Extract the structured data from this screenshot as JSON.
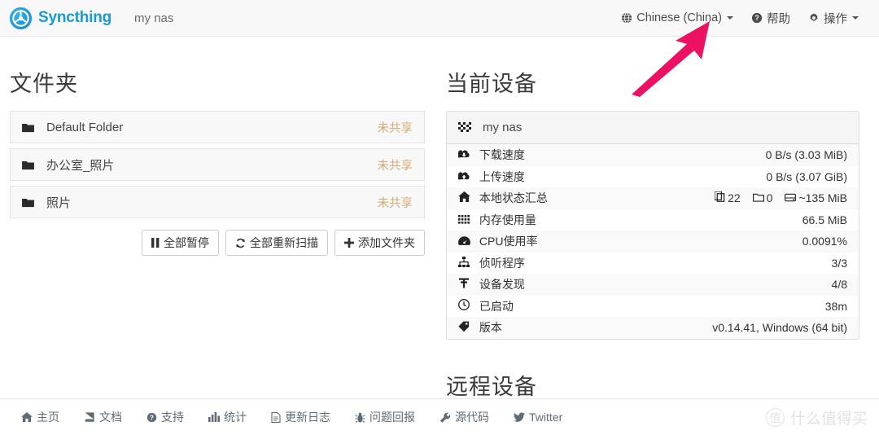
{
  "navbar": {
    "brand": "Syncthing",
    "brand_logo_icon": "syncthing-logo-icon",
    "device_name": "my nas",
    "language": {
      "label": "Chinese (China)",
      "icon": "globe-icon"
    },
    "help": {
      "label": "帮助",
      "icon": "question-circle-icon"
    },
    "actions": {
      "label": "操作",
      "icon": "gear-icon"
    }
  },
  "folders": {
    "title": "文件夹",
    "items": [
      {
        "name": "Default Folder",
        "status": "未共享",
        "icon": "folder-icon"
      },
      {
        "name": "办公室_照片",
        "status": "未共享",
        "icon": "folder-icon"
      },
      {
        "name": "照片",
        "status": "未共享",
        "icon": "folder-icon"
      }
    ],
    "buttons": [
      {
        "label": "全部暂停",
        "icon": "pause-icon"
      },
      {
        "label": "全部重新扫描",
        "icon": "refresh-icon"
      },
      {
        "label": "添加文件夹",
        "icon": "plus-icon"
      }
    ]
  },
  "this_device": {
    "title": "当前设备",
    "device_name": "my nas",
    "device_icon": "qrcode-icon",
    "stats": [
      {
        "icon": "cloud-download-icon",
        "label": "下载速度",
        "value": "0 B/s (3.03 MiB)"
      },
      {
        "icon": "cloud-upload-icon",
        "label": "上传速度",
        "value": "0 B/s (3.07 GiB)"
      },
      {
        "icon": "home-icon",
        "label": "本地状态汇总",
        "value_parts": [
          {
            "icon": "files-icon",
            "text": "22"
          },
          {
            "icon": "folder-o-icon",
            "text": "0"
          },
          {
            "icon": "hdd-icon",
            "text": "~135 MiB"
          }
        ]
      },
      {
        "icon": "th-icon",
        "label": "内存使用量",
        "value": "66.5 MiB"
      },
      {
        "icon": "tachometer-icon",
        "label": "CPU使用率",
        "value": "0.0091%"
      },
      {
        "icon": "sitemap-icon",
        "label": "侦听程序",
        "value": "3/3",
        "value_color": "#3c9a3c"
      },
      {
        "icon": "rss-icon",
        "label": "设备发现",
        "value": "4/8"
      },
      {
        "icon": "clock-icon",
        "label": "已启动",
        "value": "38m"
      },
      {
        "icon": "tag-icon",
        "label": "版本",
        "value": "v0.14.41, Windows (64 bit)"
      }
    ]
  },
  "remote_devices": {
    "title": "远程设备"
  },
  "footer": {
    "links": [
      {
        "label": "主页",
        "icon": "home-icon"
      },
      {
        "label": "文档",
        "icon": "book-icon"
      },
      {
        "label": "支持",
        "icon": "question-circle-icon"
      },
      {
        "label": "统计",
        "icon": "bar-chart-icon"
      },
      {
        "label": "更新日志",
        "icon": "file-text-icon"
      },
      {
        "label": "问题回报",
        "icon": "bug-icon"
      },
      {
        "label": "源代码",
        "icon": "wrench-icon"
      },
      {
        "label": "Twitter",
        "icon": "twitter-icon"
      }
    ]
  },
  "watermark": {
    "mark": "值",
    "text": "什么值得买"
  },
  "annotation": {
    "arrow_color": "#ED1164",
    "arrow_icon": "arrow-up-right-annotation"
  },
  "colors": {
    "brand": "#189ad3",
    "warning_text": "#d5ab7a",
    "success_text": "#3c9a3c",
    "annotation": "#ED1164"
  }
}
